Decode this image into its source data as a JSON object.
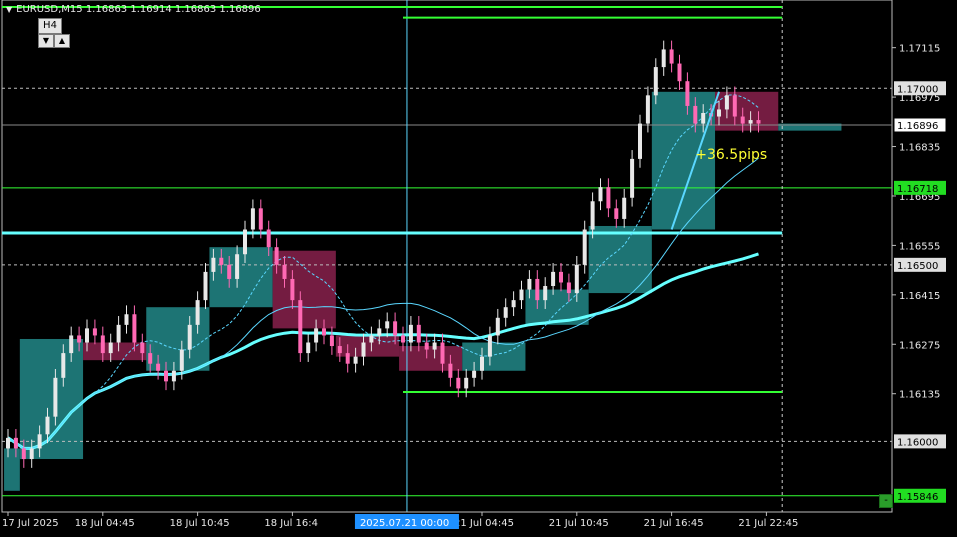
{
  "header": {
    "symbol_line": "EURUSD,M15 1.16863 1.16914 1.16863 1.16896"
  },
  "timeframe": {
    "label": "H4",
    "down_glyph": "▼",
    "up_glyph": "▲"
  },
  "pips_label": "+36.5pips",
  "minus_button": "-",
  "colors": {
    "background": "#000000",
    "bull_candle": "#e8e8e8",
    "bear_candle": "#ff69b4",
    "bull_box": "#1f7a7a",
    "bear_box": "#7a1e45",
    "hline_green": "#33ff33",
    "ma_fast": "#5ad7ff",
    "ma_slow": "#66ffff",
    "price_tag_green": "#22dd22"
  },
  "chart_data": {
    "type": "candlestick",
    "symbol": "EURUSD",
    "timeframe": "M15",
    "ohlc": {
      "open": 1.16863,
      "high": 1.16914,
      "low": 1.16863,
      "close": 1.16896
    },
    "ylim": [
      1.158,
      1.1725
    ],
    "y_ticks": [
      1.17115,
      1.16975,
      1.16835,
      1.16695,
      1.16555,
      1.16415,
      1.16275,
      1.16135
    ],
    "x_ticks": [
      "17 Jul 2025",
      "18 Jul 04:45",
      "18 Jul 10:45",
      "18 Jul 16:4",
      "21 Jul 04:45",
      "21 Jul 10:45",
      "21 Jul 16:45",
      "21 Jul 22:45"
    ],
    "x_tick_idx": [
      0,
      12,
      24,
      36,
      60,
      72,
      84,
      96
    ],
    "crosshair": {
      "label": "2025.07.21 00:00",
      "idx": 50.5
    },
    "current_price": {
      "value": 1.16896,
      "label": "1.16896"
    },
    "levels": [
      {
        "value": 1.16718,
        "label": "1.16718",
        "style": "green-tag"
      },
      {
        "value": 1.15846,
        "label": "1.15846",
        "style": "green-tag"
      },
      {
        "value": 1.17,
        "label": "1.17000",
        "style": "grey-tag"
      },
      {
        "value": 1.165,
        "label": "1.16500",
        "style": "grey-tag"
      },
      {
        "value": 1.16,
        "label": "1.16000",
        "style": "grey-tag"
      }
    ],
    "closes": [
      1.1601,
      1.1598,
      1.1595,
      1.1598,
      1.1602,
      1.1607,
      1.1618,
      1.1625,
      1.163,
      1.1628,
      1.1632,
      1.163,
      1.1625,
      1.1628,
      1.1633,
      1.1636,
      1.1628,
      1.1625,
      1.1622,
      1.162,
      1.1617,
      1.162,
      1.1626,
      1.1633,
      1.164,
      1.1648,
      1.1652,
      1.165,
      1.1646,
      1.1653,
      1.166,
      1.1666,
      1.166,
      1.1655,
      1.165,
      1.1646,
      1.164,
      1.1625,
      1.1628,
      1.1632,
      1.163,
      1.1627,
      1.1625,
      1.1622,
      1.1624,
      1.1628,
      1.163,
      1.1632,
      1.1634,
      1.163,
      1.1628,
      1.1633,
      1.1628,
      1.1626,
      1.1628,
      1.1622,
      1.1618,
      1.1615,
      1.1618,
      1.162,
      1.1624,
      1.163,
      1.1635,
      1.1638,
      1.164,
      1.1643,
      1.1646,
      1.164,
      1.1644,
      1.1648,
      1.1645,
      1.1642,
      1.165,
      1.166,
      1.1668,
      1.1672,
      1.1666,
      1.1663,
      1.1669,
      1.168,
      1.169,
      1.1698,
      1.1706,
      1.1711,
      1.1707,
      1.1702,
      1.1695,
      1.169,
      1.1693,
      1.1692,
      1.1694,
      1.1698,
      1.1692,
      1.169,
      1.1691,
      1.169
    ],
    "boxes": [
      {
        "type": "bull",
        "start": 0,
        "end": 1,
        "low": 1.1586,
        "high": 1.1598
      },
      {
        "type": "bull",
        "start": 2,
        "end": 9,
        "low": 1.1595,
        "high": 1.1629
      },
      {
        "type": "bear",
        "start": 10,
        "end": 18,
        "low": 1.1623,
        "high": 1.1628
      },
      {
        "type": "bull",
        "start": 18,
        "end": 25,
        "low": 1.162,
        "high": 1.1638
      },
      {
        "type": "bull",
        "start": 26,
        "end": 33,
        "low": 1.1638,
        "high": 1.1655
      },
      {
        "type": "bear",
        "start": 34,
        "end": 41,
        "low": 1.1632,
        "high": 1.1654
      },
      {
        "type": "bear",
        "start": 42,
        "end": 49,
        "low": 1.1624,
        "high": 1.163
      },
      {
        "type": "bear",
        "start": 50,
        "end": 57,
        "low": 1.162,
        "high": 1.1627
      },
      {
        "type": "bull",
        "start": 58,
        "end": 65,
        "low": 1.162,
        "high": 1.1628
      },
      {
        "type": "bull",
        "start": 66,
        "end": 73,
        "low": 1.1633,
        "high": 1.1643
      },
      {
        "type": "bull",
        "start": 74,
        "end": 81,
        "low": 1.1642,
        "high": 1.1661
      },
      {
        "type": "bull",
        "start": 82,
        "end": 89,
        "low": 1.166,
        "high": 1.1699
      },
      {
        "type": "bear",
        "start": 90,
        "end": 97,
        "low": 1.1688,
        "high": 1.1699
      },
      {
        "type": "bull",
        "start": 98,
        "end": 105,
        "low": 1.1688,
        "high": 1.169
      }
    ],
    "hlines": [
      {
        "value": 1.1723,
        "start": 0,
        "end": 98,
        "color": "#33ff33",
        "width": 2
      },
      {
        "value": 1.172,
        "start": 50,
        "end": 98,
        "color": "#33ff33",
        "width": 2
      },
      {
        "value": 1.1614,
        "start": 50,
        "end": 98,
        "color": "#33ff33",
        "width": 2
      },
      {
        "value": 1.1659,
        "start": 0,
        "end": 98,
        "color": "#66ffff",
        "width": 3
      }
    ],
    "trendline": {
      "from": {
        "idx": 84,
        "value": 1.166
      },
      "to": {
        "idx": 90,
        "value": 1.1699
      }
    }
  }
}
